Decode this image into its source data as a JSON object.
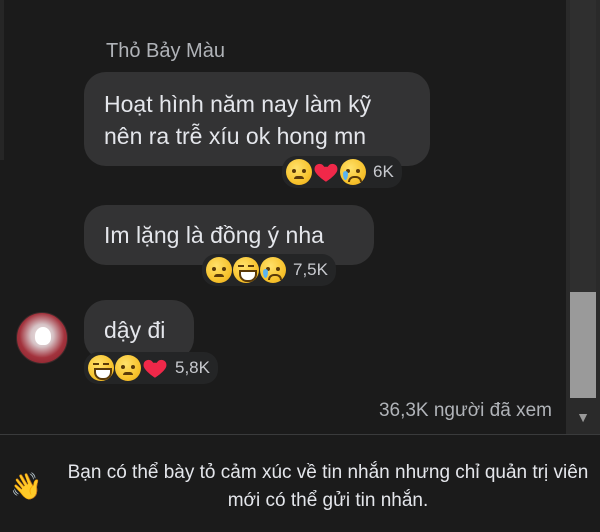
{
  "chat": {
    "sender_name": "Thỏ Bảy Màu",
    "messages": [
      {
        "text_line1": "Hoạt hình năm nay làm kỹ",
        "text_line2": "nên ra trễ xíu ok hong mn",
        "reactions": [
          "angry-face-icon",
          "heart-icon",
          "crying-face-icon"
        ],
        "reaction_count": "6K"
      },
      {
        "text": "Im lặng là đồng ý nha",
        "reactions": [
          "angry-face-icon",
          "laughing-face-icon",
          "crying-face-icon"
        ],
        "reaction_count": "7,5K"
      },
      {
        "text": "dậy đi",
        "reactions": [
          "laughing-face-icon",
          "angry-face-icon",
          "heart-icon"
        ],
        "reaction_count": "5,8K"
      }
    ],
    "seen_by": "36,3K người đã xem"
  },
  "footer": {
    "icon": "waving-hand-icon",
    "notice": "Bạn có thể bày tỏ cảm xúc về tin nhắn nhưng chỉ quản trị viên mới có thể gửi tin nhắn."
  },
  "colors": {
    "background": "#1b1b1b",
    "bubble": "#333334",
    "text": "#e4e6eb",
    "muted": "#b0b3b8",
    "heart": "#f02849"
  }
}
